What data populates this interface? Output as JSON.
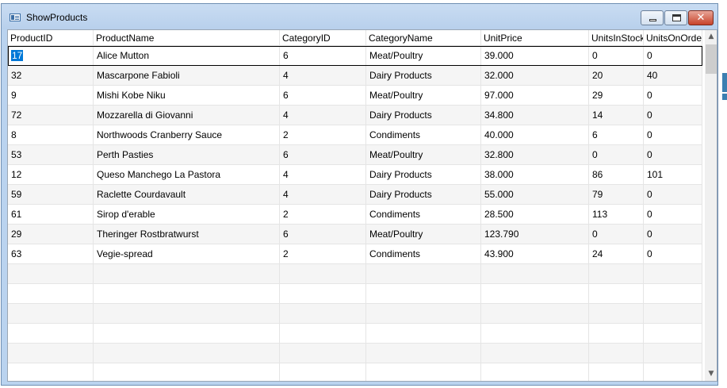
{
  "window": {
    "title": "ShowProducts",
    "icon": "form-icon",
    "controls": {
      "minimize": "minimize-icon",
      "maximize": "maximize-icon",
      "close": "✕"
    }
  },
  "grid": {
    "columns": [
      "ProductID",
      "ProductName",
      "CategoryID",
      "CategoryName",
      "UnitPrice",
      "UnitsInStock",
      "UnitsOnOrder"
    ],
    "rows": [
      [
        "17",
        "Alice Mutton",
        "6",
        "Meat/Poultry",
        "39.000",
        "0",
        "0"
      ],
      [
        "32",
        "Mascarpone Fabioli",
        "4",
        "Dairy Products",
        "32.000",
        "20",
        "40"
      ],
      [
        "9",
        "Mishi Kobe Niku",
        "6",
        "Meat/Poultry",
        "97.000",
        "29",
        "0"
      ],
      [
        "72",
        "Mozzarella di Giovanni",
        "4",
        "Dairy Products",
        "34.800",
        "14",
        "0"
      ],
      [
        "8",
        "Northwoods Cranberry Sauce",
        "2",
        "Condiments",
        "40.000",
        "6",
        "0"
      ],
      [
        "53",
        "Perth Pasties",
        "6",
        "Meat/Poultry",
        "32.800",
        "0",
        "0"
      ],
      [
        "12",
        "Queso Manchego La Pastora",
        "4",
        "Dairy Products",
        "38.000",
        "86",
        "101"
      ],
      [
        "59",
        "Raclette Courdavault",
        "4",
        "Dairy Products",
        "55.000",
        "79",
        "0"
      ],
      [
        "61",
        "Sirop d'erable",
        "2",
        "Condiments",
        "28.500",
        "113",
        "0"
      ],
      [
        "29",
        "Theringer Rostbratwurst",
        "6",
        "Meat/Poultry",
        "123.790",
        "0",
        "0"
      ],
      [
        "63",
        "Vegie-spread",
        "2",
        "Condiments",
        "43.900",
        "24",
        "0"
      ]
    ],
    "empty_rows": 6,
    "selected_cell": {
      "row": 0,
      "column": 0
    }
  },
  "scrollbar": {
    "up_icon": "▲",
    "down_icon": "▼"
  },
  "colors": {
    "selection": "#0078d7",
    "alt_row": "#f5f5f5",
    "titlebar": "#bad3ef",
    "close_button": "#c7432a"
  }
}
